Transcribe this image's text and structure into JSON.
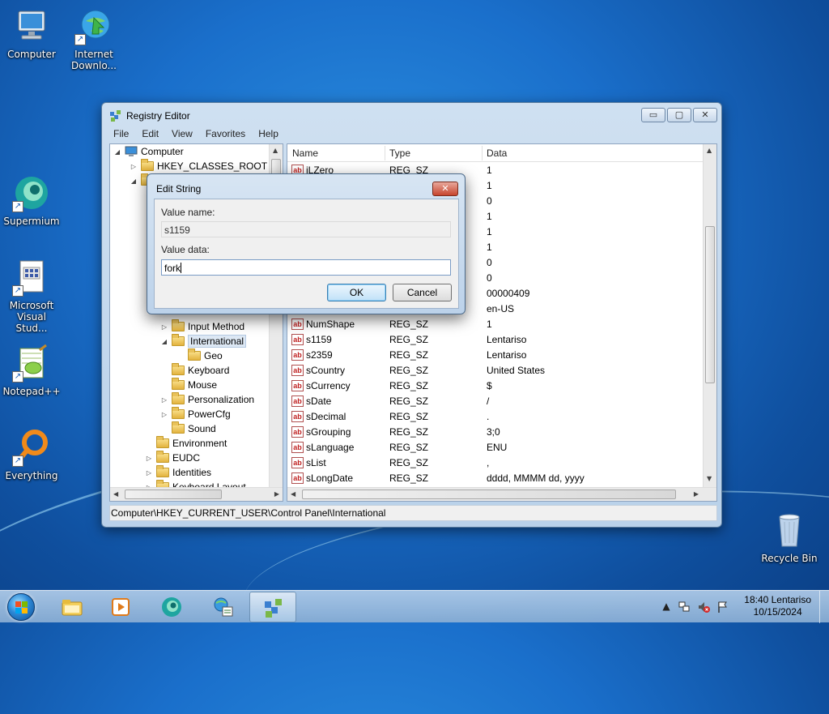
{
  "desktop": {
    "icons": [
      {
        "label": "Computer"
      },
      {
        "label": "Internet Downlo..."
      },
      {
        "label": "Supermium"
      },
      {
        "label": "Microsoft Visual Stud..."
      },
      {
        "label": "Notepad++"
      },
      {
        "label": "Everything"
      },
      {
        "label": "Recycle Bin"
      }
    ]
  },
  "window": {
    "title": "Registry Editor",
    "buttons": {
      "minimize": "▭",
      "maximize": "▢",
      "close": "✕"
    },
    "menu": [
      "File",
      "Edit",
      "View",
      "Favorites",
      "Help"
    ],
    "tree": {
      "root": "Computer",
      "items": [
        {
          "label": "HKEY_CLASSES_ROOT",
          "expander": "▷"
        },
        {
          "label": "Input Method",
          "expander": "▷"
        },
        {
          "label": "International",
          "expander": "◢"
        },
        {
          "label": "Geo",
          "expander": ""
        },
        {
          "label": "Keyboard",
          "expander": ""
        },
        {
          "label": "Mouse",
          "expander": ""
        },
        {
          "label": "Personalization",
          "expander": "▷"
        },
        {
          "label": "PowerCfg",
          "expander": "▷"
        },
        {
          "label": "Sound",
          "expander": ""
        },
        {
          "label": "Environment",
          "expander": ""
        },
        {
          "label": "EUDC",
          "expander": "▷"
        },
        {
          "label": "Identities",
          "expander": "▷"
        },
        {
          "label": "Keyboard Layout",
          "expander": "▷"
        }
      ]
    },
    "list": {
      "columns": [
        "Name",
        "Type",
        "Data"
      ],
      "rows": [
        {
          "name": "iLZero",
          "type": "REG_SZ",
          "data": "1"
        },
        {
          "name": "",
          "type": "",
          "data": "1"
        },
        {
          "name": "",
          "type": "",
          "data": "0"
        },
        {
          "name": "",
          "type": "",
          "data": "1"
        },
        {
          "name": "",
          "type": "",
          "data": "1"
        },
        {
          "name": "",
          "type": "",
          "data": "1"
        },
        {
          "name": "",
          "type": "",
          "data": "0"
        },
        {
          "name": "",
          "type": "",
          "data": "0"
        },
        {
          "name": "",
          "type": "",
          "data": "00000409"
        },
        {
          "name": "",
          "type": "",
          "data": "en-US"
        },
        {
          "name": "NumShape",
          "type": "REG_SZ",
          "data": "1"
        },
        {
          "name": "s1159",
          "type": "REG_SZ",
          "data": "Lentariso"
        },
        {
          "name": "s2359",
          "type": "REG_SZ",
          "data": "Lentariso"
        },
        {
          "name": "sCountry",
          "type": "REG_SZ",
          "data": "United States"
        },
        {
          "name": "sCurrency",
          "type": "REG_SZ",
          "data": "$"
        },
        {
          "name": "sDate",
          "type": "REG_SZ",
          "data": "/"
        },
        {
          "name": "sDecimal",
          "type": "REG_SZ",
          "data": "."
        },
        {
          "name": "sGrouping",
          "type": "REG_SZ",
          "data": "3;0"
        },
        {
          "name": "sLanguage",
          "type": "REG_SZ",
          "data": "ENU"
        },
        {
          "name": "sList",
          "type": "REG_SZ",
          "data": ","
        },
        {
          "name": "sLongDate",
          "type": "REG_SZ",
          "data": "dddd, MMMM dd, yyyy"
        }
      ],
      "type_icon": "ab"
    },
    "status_path": "Computer\\HKEY_CURRENT_USER\\Control Panel\\International"
  },
  "dialog": {
    "title": "Edit String",
    "close": "✕",
    "value_name_label": "Value name:",
    "value_name": "s1159",
    "value_data_label": "Value data:",
    "value_data": "fork",
    "ok": "OK",
    "cancel": "Cancel"
  },
  "taskbar": {
    "time": "18:40 Lentariso",
    "date": "10/15/2024"
  }
}
